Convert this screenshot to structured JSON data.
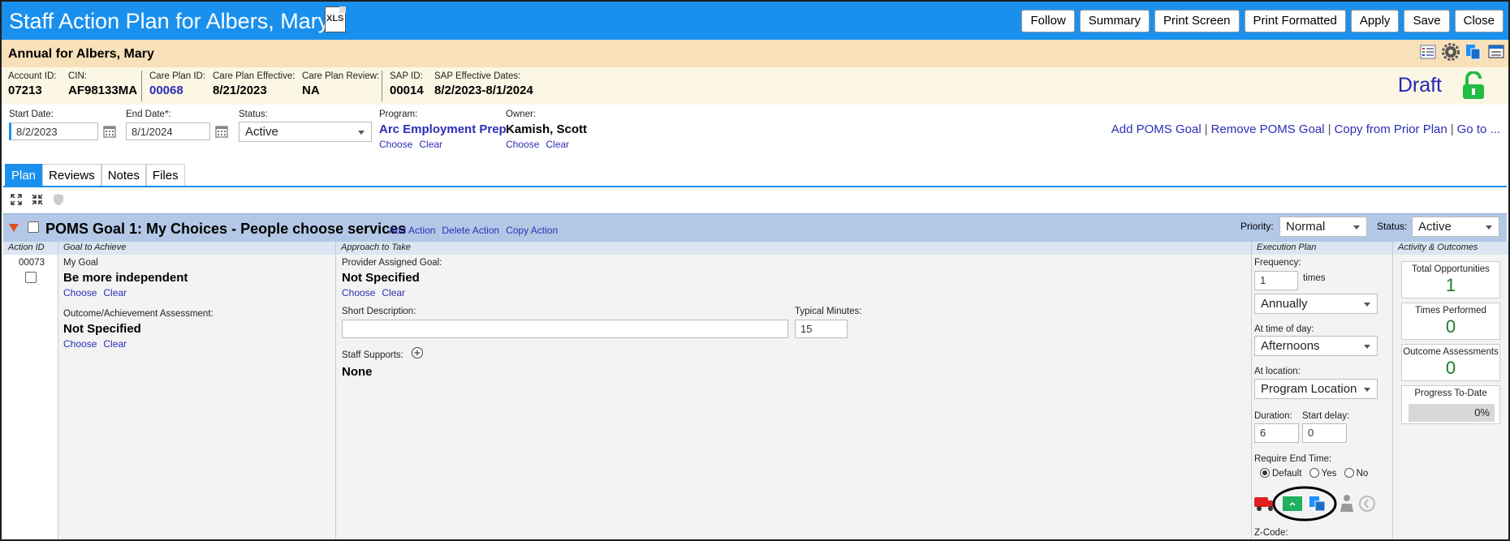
{
  "window": {
    "title": "Staff Action Plan for Albers, Mary",
    "xls_label": "XLS",
    "buttons": [
      "Follow",
      "Summary",
      "Print Screen",
      "Print Formatted",
      "Apply",
      "Save",
      "Close"
    ]
  },
  "plan_header": {
    "title": "Annual for Albers, Mary",
    "account_id_label": "Account ID:",
    "account_id": "07213",
    "cin_label": "CIN:",
    "cin": "AF98133MA",
    "care_plan_id_label": "Care Plan ID:",
    "care_plan_id": "00068",
    "care_plan_effective_label": "Care Plan Effective:",
    "care_plan_effective": "8/21/2023",
    "care_plan_review_label": "Care Plan Review:",
    "care_plan_review": "NA",
    "sap_id_label": "SAP ID:",
    "sap_id": "00014",
    "sap_dates_label": "SAP Effective Dates:",
    "sap_dates": "8/2/2023-8/1/2024",
    "state": "Draft"
  },
  "form": {
    "start_date_label": "Start Date:",
    "start_date": "8/2/2023",
    "end_date_label": "End Date*:",
    "end_date": "8/1/2024",
    "status_label": "Status:",
    "status": "Active",
    "program_label": "Program:",
    "program": "Arc Employment Prep",
    "owner_label": "Owner:",
    "owner": "Kamish, Scott",
    "choose": "Choose",
    "clear": "Clear",
    "links": {
      "add_goal": "Add POMS Goal",
      "remove_goal": "Remove POMS Goal",
      "copy_prior": "Copy from Prior Plan",
      "goto": "Go to ..."
    },
    "link_sep": "|"
  },
  "tabs": [
    "Plan",
    "Reviews",
    "Notes",
    "Files"
  ],
  "goal": {
    "title_prefix": "POMS Goal ",
    "number": "1",
    "title_rest": ": My Choices - People choose services",
    "add_action": "Add Action",
    "delete_action": "Delete Action",
    "copy_action": "Copy Action",
    "priority_label": "Priority:",
    "priority": "Normal",
    "status_label": "Status:",
    "status": "Active"
  },
  "columns": {
    "action_id": "Action ID",
    "goal_to_achieve": "Goal to Achieve",
    "approach": "Approach to Take",
    "execution": "Execution Plan",
    "activity": "Activity & Outcomes"
  },
  "action": {
    "id": "00073",
    "my_goal_label": "My Goal",
    "my_goal": "Be more independent",
    "outcome_label": "Outcome/Achievement Assessment:",
    "outcome": "Not Specified",
    "provider_goal_label": "Provider Assigned Goal:",
    "provider_goal": "Not Specified",
    "short_desc_label": "Short Description:",
    "short_desc": "",
    "typical_minutes_label": "Typical Minutes:",
    "typical_minutes": "15",
    "staff_supports_label": "Staff Supports:",
    "staff_supports": "None"
  },
  "execution": {
    "frequency_label": "Frequency:",
    "frequency": "1",
    "times_label": "times",
    "period": "Annually",
    "time_of_day_label": "At time of day:",
    "time_of_day": "Afternoons",
    "location_label": "At location:",
    "location": "Program Location",
    "duration_label": "Duration:",
    "duration": "6",
    "start_delay_label": "Start delay:",
    "start_delay": "0",
    "require_end_label": "Require End Time:",
    "opt_default": "Default",
    "opt_yes": "Yes",
    "opt_no": "No",
    "zcode_label": "Z-Code:"
  },
  "outcomes": {
    "total_label": "Total Opportunities",
    "total": "1",
    "performed_label": "Times Performed",
    "performed": "0",
    "assess_label": "Outcome Assessments",
    "assess": "0",
    "progress_label": "Progress To-Date",
    "progress": "0%"
  }
}
